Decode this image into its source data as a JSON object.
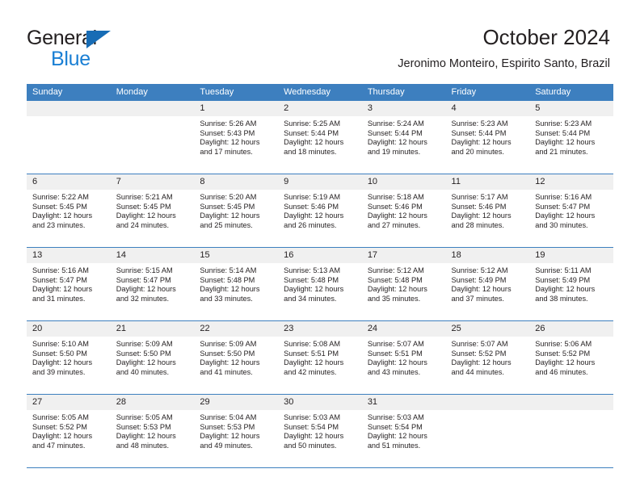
{
  "brand": {
    "word_top": "General",
    "word_bottom": "Blue",
    "triangle_icon": "triangle-icon",
    "accent_color": "#176cb5",
    "blue_text_color": "#1a7fd4"
  },
  "header": {
    "title": "October 2024",
    "subtitle": "Jeronimo Monteiro, Espirito Santo, Brazil"
  },
  "colors": {
    "header_row_bg": "#3d7fbf",
    "daynum_bg": "#f0f0f0",
    "grid_line": "#3d7fbf",
    "text": "#231f20"
  },
  "weekday_headers": [
    "Sunday",
    "Monday",
    "Tuesday",
    "Wednesday",
    "Thursday",
    "Friday",
    "Saturday"
  ],
  "labels": {
    "sunrise": "Sunrise:",
    "sunset": "Sunset:",
    "daylight": "Daylight:"
  },
  "weeks": [
    [
      {
        "day": "",
        "empty": true
      },
      {
        "day": "",
        "empty": true
      },
      {
        "day": "1",
        "sunrise": "Sunrise: 5:26 AM",
        "sunset": "Sunset: 5:43 PM",
        "daylight": "Daylight: 12 hours and 17 minutes."
      },
      {
        "day": "2",
        "sunrise": "Sunrise: 5:25 AM",
        "sunset": "Sunset: 5:44 PM",
        "daylight": "Daylight: 12 hours and 18 minutes."
      },
      {
        "day": "3",
        "sunrise": "Sunrise: 5:24 AM",
        "sunset": "Sunset: 5:44 PM",
        "daylight": "Daylight: 12 hours and 19 minutes."
      },
      {
        "day": "4",
        "sunrise": "Sunrise: 5:23 AM",
        "sunset": "Sunset: 5:44 PM",
        "daylight": "Daylight: 12 hours and 20 minutes."
      },
      {
        "day": "5",
        "sunrise": "Sunrise: 5:23 AM",
        "sunset": "Sunset: 5:44 PM",
        "daylight": "Daylight: 12 hours and 21 minutes."
      }
    ],
    [
      {
        "day": "6",
        "sunrise": "Sunrise: 5:22 AM",
        "sunset": "Sunset: 5:45 PM",
        "daylight": "Daylight: 12 hours and 23 minutes."
      },
      {
        "day": "7",
        "sunrise": "Sunrise: 5:21 AM",
        "sunset": "Sunset: 5:45 PM",
        "daylight": "Daylight: 12 hours and 24 minutes."
      },
      {
        "day": "8",
        "sunrise": "Sunrise: 5:20 AM",
        "sunset": "Sunset: 5:45 PM",
        "daylight": "Daylight: 12 hours and 25 minutes."
      },
      {
        "day": "9",
        "sunrise": "Sunrise: 5:19 AM",
        "sunset": "Sunset: 5:46 PM",
        "daylight": "Daylight: 12 hours and 26 minutes."
      },
      {
        "day": "10",
        "sunrise": "Sunrise: 5:18 AM",
        "sunset": "Sunset: 5:46 PM",
        "daylight": "Daylight: 12 hours and 27 minutes."
      },
      {
        "day": "11",
        "sunrise": "Sunrise: 5:17 AM",
        "sunset": "Sunset: 5:46 PM",
        "daylight": "Daylight: 12 hours and 28 minutes."
      },
      {
        "day": "12",
        "sunrise": "Sunrise: 5:16 AM",
        "sunset": "Sunset: 5:47 PM",
        "daylight": "Daylight: 12 hours and 30 minutes."
      }
    ],
    [
      {
        "day": "13",
        "sunrise": "Sunrise: 5:16 AM",
        "sunset": "Sunset: 5:47 PM",
        "daylight": "Daylight: 12 hours and 31 minutes."
      },
      {
        "day": "14",
        "sunrise": "Sunrise: 5:15 AM",
        "sunset": "Sunset: 5:47 PM",
        "daylight": "Daylight: 12 hours and 32 minutes."
      },
      {
        "day": "15",
        "sunrise": "Sunrise: 5:14 AM",
        "sunset": "Sunset: 5:48 PM",
        "daylight": "Daylight: 12 hours and 33 minutes."
      },
      {
        "day": "16",
        "sunrise": "Sunrise: 5:13 AM",
        "sunset": "Sunset: 5:48 PM",
        "daylight": "Daylight: 12 hours and 34 minutes."
      },
      {
        "day": "17",
        "sunrise": "Sunrise: 5:12 AM",
        "sunset": "Sunset: 5:48 PM",
        "daylight": "Daylight: 12 hours and 35 minutes."
      },
      {
        "day": "18",
        "sunrise": "Sunrise: 5:12 AM",
        "sunset": "Sunset: 5:49 PM",
        "daylight": "Daylight: 12 hours and 37 minutes."
      },
      {
        "day": "19",
        "sunrise": "Sunrise: 5:11 AM",
        "sunset": "Sunset: 5:49 PM",
        "daylight": "Daylight: 12 hours and 38 minutes."
      }
    ],
    [
      {
        "day": "20",
        "sunrise": "Sunrise: 5:10 AM",
        "sunset": "Sunset: 5:50 PM",
        "daylight": "Daylight: 12 hours and 39 minutes."
      },
      {
        "day": "21",
        "sunrise": "Sunrise: 5:09 AM",
        "sunset": "Sunset: 5:50 PM",
        "daylight": "Daylight: 12 hours and 40 minutes."
      },
      {
        "day": "22",
        "sunrise": "Sunrise: 5:09 AM",
        "sunset": "Sunset: 5:50 PM",
        "daylight": "Daylight: 12 hours and 41 minutes."
      },
      {
        "day": "23",
        "sunrise": "Sunrise: 5:08 AM",
        "sunset": "Sunset: 5:51 PM",
        "daylight": "Daylight: 12 hours and 42 minutes."
      },
      {
        "day": "24",
        "sunrise": "Sunrise: 5:07 AM",
        "sunset": "Sunset: 5:51 PM",
        "daylight": "Daylight: 12 hours and 43 minutes."
      },
      {
        "day": "25",
        "sunrise": "Sunrise: 5:07 AM",
        "sunset": "Sunset: 5:52 PM",
        "daylight": "Daylight: 12 hours and 44 minutes."
      },
      {
        "day": "26",
        "sunrise": "Sunrise: 5:06 AM",
        "sunset": "Sunset: 5:52 PM",
        "daylight": "Daylight: 12 hours and 46 minutes."
      }
    ],
    [
      {
        "day": "27",
        "sunrise": "Sunrise: 5:05 AM",
        "sunset": "Sunset: 5:52 PM",
        "daylight": "Daylight: 12 hours and 47 minutes."
      },
      {
        "day": "28",
        "sunrise": "Sunrise: 5:05 AM",
        "sunset": "Sunset: 5:53 PM",
        "daylight": "Daylight: 12 hours and 48 minutes."
      },
      {
        "day": "29",
        "sunrise": "Sunrise: 5:04 AM",
        "sunset": "Sunset: 5:53 PM",
        "daylight": "Daylight: 12 hours and 49 minutes."
      },
      {
        "day": "30",
        "sunrise": "Sunrise: 5:03 AM",
        "sunset": "Sunset: 5:54 PM",
        "daylight": "Daylight: 12 hours and 50 minutes."
      },
      {
        "day": "31",
        "sunrise": "Sunrise: 5:03 AM",
        "sunset": "Sunset: 5:54 PM",
        "daylight": "Daylight: 12 hours and 51 minutes."
      },
      {
        "day": "",
        "empty": true
      },
      {
        "day": "",
        "empty": true
      }
    ]
  ]
}
